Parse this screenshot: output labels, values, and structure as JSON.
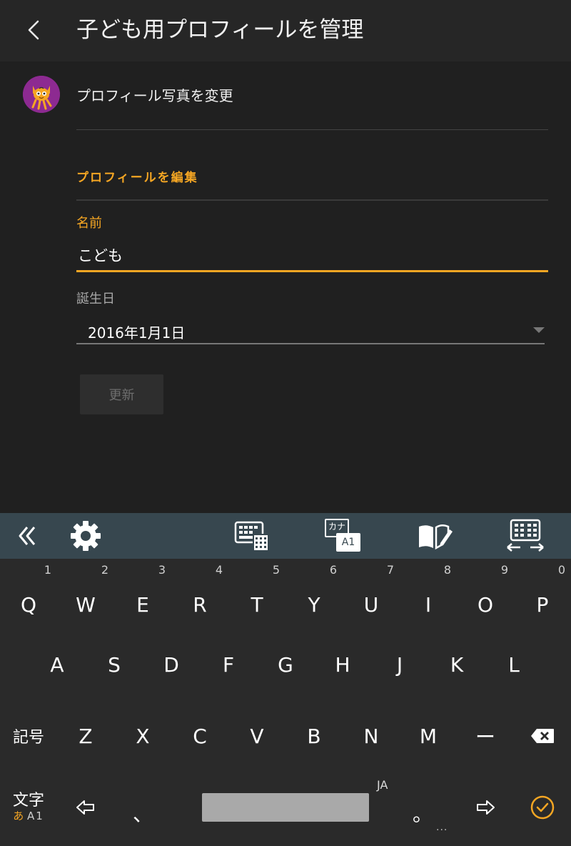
{
  "appbar": {
    "title": "子ども用プロフィールを管理",
    "back_icon": "chevron-left-icon"
  },
  "profile": {
    "avatar_icon": "cat-avatar-icon",
    "change_photo": "プロフィール写真を変更",
    "section_title": "プロフィールを編集",
    "name_label": "名前",
    "name_value": "こども",
    "birthday_label": "誕生日",
    "birthday_value": "2016年1月1日",
    "update_button": "更新"
  },
  "keyboard_toolbar": {
    "icons": [
      "collapse-icon",
      "settings-icon",
      "keyboard-layout-icon",
      "kana-a1-icon",
      "dictionary-icon",
      "resize-keyboard-icon"
    ],
    "kana_label": "カナ",
    "a1_label": "A1"
  },
  "keyboard": {
    "row1": [
      {
        "key": "Q",
        "num": "1"
      },
      {
        "key": "W",
        "num": "2"
      },
      {
        "key": "E",
        "num": "3"
      },
      {
        "key": "R",
        "num": "4"
      },
      {
        "key": "T",
        "num": "5"
      },
      {
        "key": "Y",
        "num": "6"
      },
      {
        "key": "U",
        "num": "7"
      },
      {
        "key": "I",
        "num": "8"
      },
      {
        "key": "O",
        "num": "9"
      },
      {
        "key": "P",
        "num": "0"
      }
    ],
    "row2": [
      "A",
      "S",
      "D",
      "F",
      "G",
      "H",
      "J",
      "K",
      "L"
    ],
    "row3": {
      "symbols": "記号",
      "keys": [
        "Z",
        "X",
        "C",
        "V",
        "B",
        "N",
        "M"
      ],
      "dash": "ー",
      "backspace_icon": "backspace-icon"
    },
    "row4": {
      "mode_label": "文字",
      "mode_sub_a": "あ",
      "mode_sub_b": "A1",
      "left_icon": "arrow-left-icon",
      "comma": "、",
      "ja_label": "JA",
      "period": "。",
      "right_icon": "arrow-right-icon",
      "enter_icon": "check-circle-icon",
      "more": "..."
    },
    "accent": "#f5a623"
  }
}
